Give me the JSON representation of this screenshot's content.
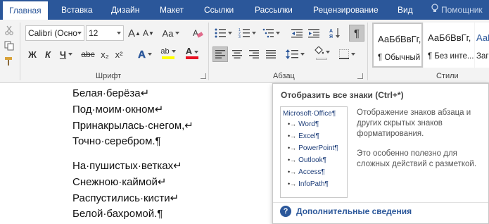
{
  "tabs": {
    "home": "Главная",
    "insert": "Вставка",
    "design": "Дизайн",
    "layout": "Макет",
    "references": "Ссылки",
    "mailings": "Рассылки",
    "review": "Рецензирование",
    "view": "Вид",
    "tell_me": "Помощник"
  },
  "font_group": {
    "label": "Шрифт",
    "font_name": "Calibri (Осно",
    "font_size": "12",
    "grow_font": "A",
    "shrink_font": "A",
    "change_case": "Aa",
    "bold": "Ж",
    "italic": "К",
    "underline": "Ч",
    "strikethrough": "abc",
    "subscript": "x₂",
    "superscript": "x²",
    "text_effects": "A",
    "highlight_text": "ab",
    "font_color_text": "A"
  },
  "paragraph_group": {
    "label": "Абзац",
    "show_marks_glyph": "¶"
  },
  "styles_group": {
    "label": "Стили",
    "items": [
      {
        "preview": "АаБбВвГг,",
        "name": "¶ Обычный"
      },
      {
        "preview": "АаБбВвГг,",
        "name": "¶ Без инте..."
      },
      {
        "preview": "АаБ",
        "name": "Заг"
      }
    ]
  },
  "document": {
    "lines": [
      "Белая·берёза↵",
      "Под·моим·окном↵",
      "Принакрылась·снегом,↵",
      "Точно·серебром.¶",
      "На·пушистых·ветках↵",
      "Снежною·каймой↵",
      "Распустились·кисти↵",
      "Белой·бахромой.¶"
    ]
  },
  "tooltip": {
    "title": "Отобразить все знаки (Ctrl+*)",
    "preview_root": "Microsoft·Office¶",
    "preview_items": [
      "Word¶",
      "Excel¶",
      "PowerPoint¶",
      "Outlook¶",
      "Access¶",
      "InfoPath¶"
    ],
    "description_1": "Отображение знаков абзаца и других скрытых знаков форматирования.",
    "description_2": "Это особенно полезно для сложных действий с разметкой.",
    "help_link": "Дополнительные сведения"
  },
  "colors": {
    "accent": "#2b579a",
    "highlight_yellow": "#ffff00",
    "font_color_red": "#e81123"
  }
}
